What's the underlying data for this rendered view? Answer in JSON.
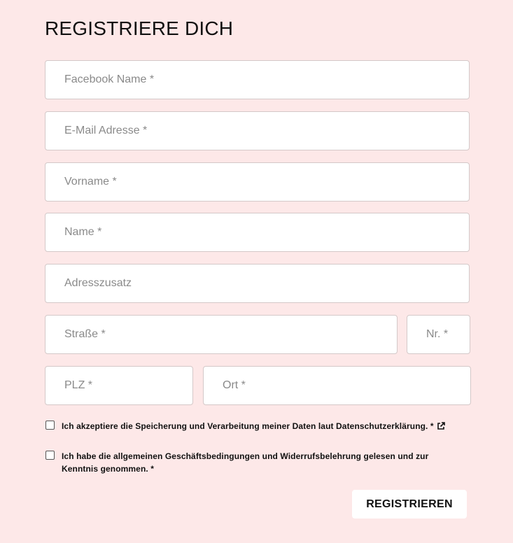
{
  "form": {
    "title": "REGISTRIERE DICH",
    "fields": {
      "facebook_name": "Facebook Name *",
      "email": "E-Mail Adresse *",
      "first_name": "Vorname *",
      "last_name": "Name *",
      "address_addition": "Adresszusatz",
      "street": "Straße *",
      "house_number": "Nr. *",
      "zip": "PLZ *",
      "city": "Ort *"
    },
    "consents": {
      "privacy_label": "Ich akzeptiere die Speicherung und Verarbeitung meiner Daten laut Datenschutzerklärung. *",
      "terms_label": "Ich habe die allgemeinen Geschäftsbedingungen und Widerrufsbelehrung gelesen und zur Kenntnis genommen. *"
    },
    "submit_label": "REGISTRIEREN"
  },
  "colors": {
    "background": "#fde8e8",
    "field_background": "#ffffff",
    "field_border": "#d4c8c8",
    "text": "#111111",
    "placeholder": "#8a8a8a"
  },
  "icons": {
    "privacy_link": "external-link-icon"
  }
}
